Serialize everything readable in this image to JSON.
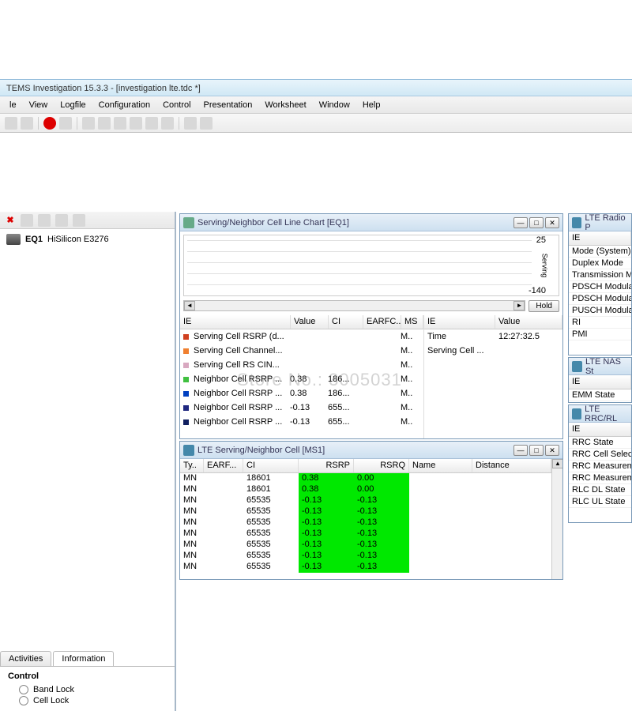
{
  "title": "TEMS Investigation 15.3.3 - [investigation lte.tdc *]",
  "menu": [
    "le",
    "View",
    "Logfile",
    "Configuration",
    "Control",
    "Presentation",
    "Worksheet",
    "Window",
    "Help"
  ],
  "device": {
    "id": "EQ1",
    "name": "HiSilicon E3276"
  },
  "tabs": {
    "activities": "Activities",
    "information": "Information"
  },
  "control": {
    "header": "Control",
    "band_lock": "Band Lock",
    "cell_lock": "Cell Lock"
  },
  "panel1": {
    "title": "Serving/Neighbor Cell Line Chart [EQ1]",
    "yaxis": {
      "top": "25",
      "bottom": "-140",
      "label": "Serving"
    },
    "hold": "Hold",
    "left_headers": {
      "ie": "IE",
      "value": "Value",
      "ci": "CI",
      "earfc": "EARFC..",
      "ms": "MS"
    },
    "right_headers": {
      "ie": "IE",
      "value": "Value"
    },
    "ie_rows": [
      {
        "marker": "#d04020",
        "label": "Serving Cell RSRP (d...",
        "value": "",
        "ci": "",
        "ms": "M.."
      },
      {
        "marker": "#f08030",
        "label": "Serving Cell Channel...",
        "value": "",
        "ci": "",
        "ms": "M.."
      },
      {
        "marker": "#d8a8c0",
        "label": "Serving Cell RS CIN...",
        "value": "",
        "ci": "",
        "ms": "M.."
      },
      {
        "marker": "#40c040",
        "label": "Neighbor Cell RSRP ...",
        "value": "0.38",
        "ci": "186...",
        "ms": "M.."
      },
      {
        "marker": "#0040c0",
        "label": "Neighbor Cell RSRP ...",
        "value": "0.38",
        "ci": "186...",
        "ms": "M.."
      },
      {
        "marker": "#202880",
        "label": "Neighbor Cell RSRP ...",
        "value": "-0.13",
        "ci": "655...",
        "ms": "M.."
      },
      {
        "marker": "#102060",
        "label": "Neighbor Cell RSRP ...",
        "value": "-0.13",
        "ci": "655...",
        "ms": "M.."
      }
    ],
    "right_rows": [
      {
        "ie": "Time",
        "value": "12:27:32.5"
      },
      {
        "ie": "Serving Cell ...",
        "value": ""
      }
    ]
  },
  "panel2": {
    "title": "LTE Serving/Neighbor Cell [MS1]",
    "headers": {
      "ty": "Ty..",
      "earf": "EARF...",
      "ci": "CI",
      "rsrp": "RSRP",
      "rsrq": "RSRQ",
      "name": "Name",
      "distance": "Distance"
    },
    "rows": [
      {
        "ty": "MN",
        "earf": "",
        "ci": "18601",
        "rsrp": "0.38",
        "rsrq": "0.00"
      },
      {
        "ty": "MN",
        "earf": "",
        "ci": "18601",
        "rsrp": "0.38",
        "rsrq": "0.00"
      },
      {
        "ty": "MN",
        "earf": "",
        "ci": "65535",
        "rsrp": "-0.13",
        "rsrq": "-0.13"
      },
      {
        "ty": "MN",
        "earf": "",
        "ci": "65535",
        "rsrp": "-0.13",
        "rsrq": "-0.13"
      },
      {
        "ty": "MN",
        "earf": "",
        "ci": "65535",
        "rsrp": "-0.13",
        "rsrq": "-0.13"
      },
      {
        "ty": "MN",
        "earf": "",
        "ci": "65535",
        "rsrp": "-0.13",
        "rsrq": "-0.13"
      },
      {
        "ty": "MN",
        "earf": "",
        "ci": "65535",
        "rsrp": "-0.13",
        "rsrq": "-0.13"
      },
      {
        "ty": "MN",
        "earf": "",
        "ci": "65535",
        "rsrp": "-0.13",
        "rsrq": "-0.13"
      },
      {
        "ty": "MN",
        "earf": "",
        "ci": "65535",
        "rsrp": "-0.13",
        "rsrq": "-0.13"
      }
    ]
  },
  "rp1": {
    "title": "LTE Radio P",
    "hdr": "IE",
    "rows": [
      "Mode (System)",
      "Duplex Mode",
      "Transmission Mo",
      "PDSCH Modulati",
      "PDSCH Modulati",
      "PUSCH Modulati",
      "RI",
      "PMI"
    ]
  },
  "rp2": {
    "title": "LTE NAS St",
    "hdr": "IE",
    "rows": [
      "EMM State"
    ]
  },
  "rp3": {
    "title": "LTE RRC/RL",
    "hdr": "IE",
    "rows": [
      "RRC State",
      "RRC Cell Selecti",
      "RRC Measureme",
      "RRC Measureme",
      "RLC DL State",
      "RLC UL State"
    ]
  },
  "watermark": "Store No.: 3005031"
}
